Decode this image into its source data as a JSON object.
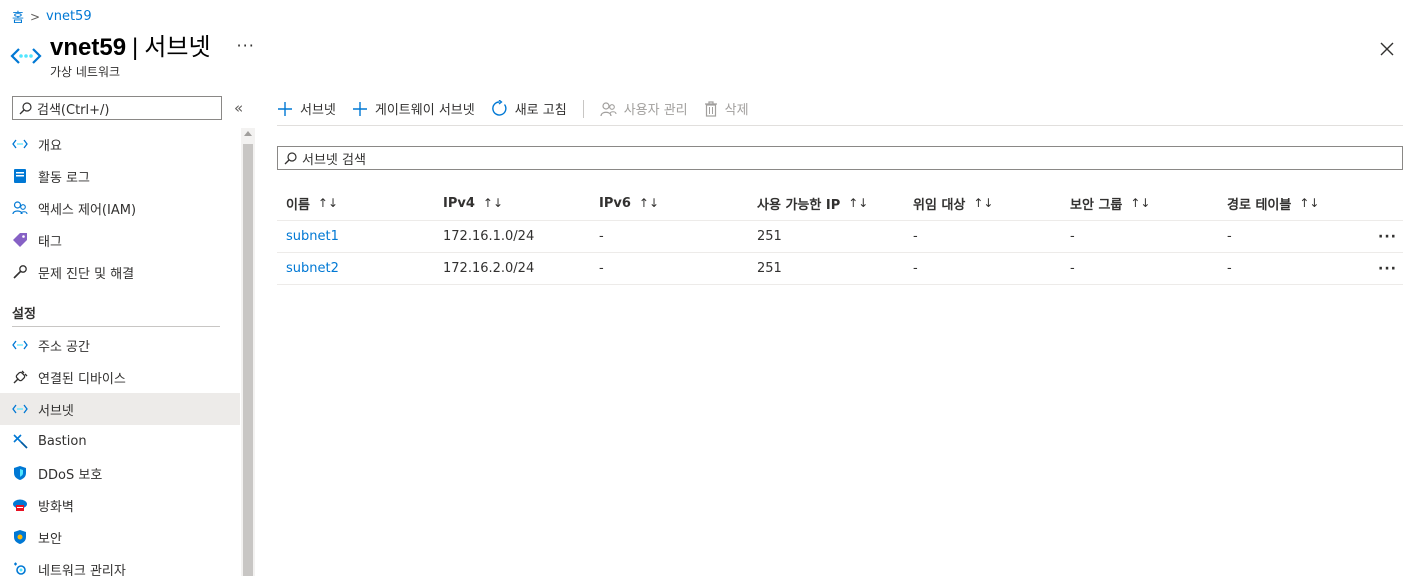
{
  "breadcrumb": {
    "home": "홈",
    "current": "vnet59"
  },
  "header": {
    "resource_name": "vnet59",
    "separator": "|",
    "blade_title": "서브넷",
    "subtitle": "가상 네트워크",
    "more_label": "···"
  },
  "sidebar": {
    "search_placeholder": "검색(Ctrl+/)",
    "collapse_label": "«",
    "top_items": [
      {
        "label": "개요",
        "icon": "vnet-icon"
      },
      {
        "label": "활동 로그",
        "icon": "activity-log-icon"
      },
      {
        "label": "액세스 제어(IAM)",
        "icon": "people-icon"
      },
      {
        "label": "태그",
        "icon": "tag-icon"
      },
      {
        "label": "문제 진단 및 해결",
        "icon": "wrench-icon"
      }
    ],
    "section_title": "설정",
    "settings_items": [
      {
        "label": "주소 공간",
        "icon": "vnet-icon"
      },
      {
        "label": "연결된 디바이스",
        "icon": "plug-icon"
      },
      {
        "label": "서브넷",
        "icon": "vnet-icon",
        "selected": true
      },
      {
        "label": "Bastion",
        "icon": "bastion-icon"
      },
      {
        "label": "DDoS 보호",
        "icon": "shield-icon"
      },
      {
        "label": "방화벽",
        "icon": "firewall-icon"
      },
      {
        "label": "보안",
        "icon": "security-icon"
      },
      {
        "label": "네트워크 관리자",
        "icon": "network-manager-icon"
      }
    ]
  },
  "toolbar": {
    "add_subnet": "서브넷",
    "add_gateway_subnet": "게이트웨이 서브넷",
    "refresh": "새로 고침",
    "manage_users": "사용자 관리",
    "delete": "삭제"
  },
  "content": {
    "search_placeholder": "서브넷 검색"
  },
  "table": {
    "sort_glyph": "↑↓",
    "columns": [
      "이름",
      "IPv4",
      "IPv6",
      "사용 가능한 IP",
      "위임 대상",
      "보안 그룹",
      "경로 테이블"
    ],
    "rows": [
      [
        "subnet1",
        "172.16.1.0/24",
        "-",
        "251",
        "-",
        "-",
        "-"
      ],
      [
        "subnet2",
        "172.16.2.0/24",
        "-",
        "251",
        "-",
        "-",
        "-"
      ]
    ],
    "row_more": "···"
  },
  "colors": {
    "link": "#0078d4",
    "selected_bg": "#edebe9",
    "vnet_icon_blue": "#50e6ff",
    "vnet_icon_dark": "#0078d4"
  }
}
